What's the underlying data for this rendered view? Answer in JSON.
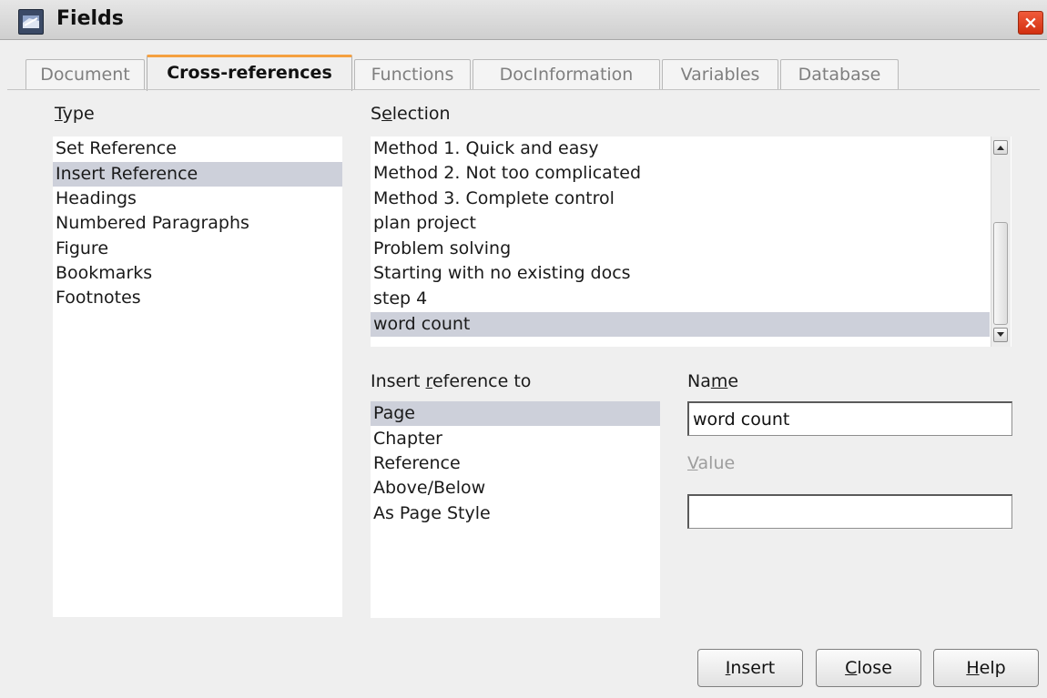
{
  "window": {
    "title": "Fields",
    "close_glyph": "×",
    "app_icon": "document-fields-icon"
  },
  "tabs": [
    {
      "label": "Document",
      "active": false
    },
    {
      "label": "Cross-references",
      "active": true
    },
    {
      "label": "Functions",
      "active": false
    },
    {
      "label": "DocInformation",
      "active": false
    },
    {
      "label": "Variables",
      "active": false
    },
    {
      "label": "Database",
      "active": false
    }
  ],
  "type": {
    "label_mnemonic": "T",
    "label_rest": "ype",
    "items": [
      {
        "label": "Set Reference",
        "selected": false
      },
      {
        "label": "Insert Reference",
        "selected": true
      },
      {
        "label": "Headings",
        "selected": false
      },
      {
        "label": "Numbered Paragraphs",
        "selected": false
      },
      {
        "label": "Figure",
        "selected": false
      },
      {
        "label": "Bookmarks",
        "selected": false
      },
      {
        "label": "Footnotes",
        "selected": false
      }
    ]
  },
  "selection": {
    "label_pre": "S",
    "label_mnemonic": "e",
    "label_post": "lection",
    "items": [
      {
        "label": "Method 1. Quick and easy",
        "selected": false
      },
      {
        "label": "Method 2. Not too complicated",
        "selected": false
      },
      {
        "label": "Method 3. Complete control",
        "selected": false
      },
      {
        "label": "plan project",
        "selected": false
      },
      {
        "label": "Problem solving",
        "selected": false
      },
      {
        "label": "Starting with no existing docs",
        "selected": false
      },
      {
        "label": "step 4",
        "selected": false
      },
      {
        "label": "word count",
        "selected": true
      }
    ]
  },
  "insert_ref": {
    "label_pre": "Insert ",
    "label_mnemonic": "r",
    "label_post": "eference to",
    "items": [
      {
        "label": "Page",
        "selected": true
      },
      {
        "label": "Chapter",
        "selected": false
      },
      {
        "label": "Reference",
        "selected": false
      },
      {
        "label": "Above/Below",
        "selected": false
      },
      {
        "label": "As Page Style",
        "selected": false
      }
    ]
  },
  "name": {
    "label_pre": "Na",
    "label_mnemonic": "m",
    "label_post": "e",
    "value": "word count"
  },
  "value_field": {
    "label_mnemonic": "V",
    "label_post": "alue",
    "value": ""
  },
  "buttons": {
    "insert": {
      "mnemonic": "I",
      "rest": "nsert"
    },
    "close": {
      "mnemonic": "C",
      "rest": "lose"
    },
    "help": {
      "mnemonic": "H",
      "rest": "elp"
    }
  }
}
